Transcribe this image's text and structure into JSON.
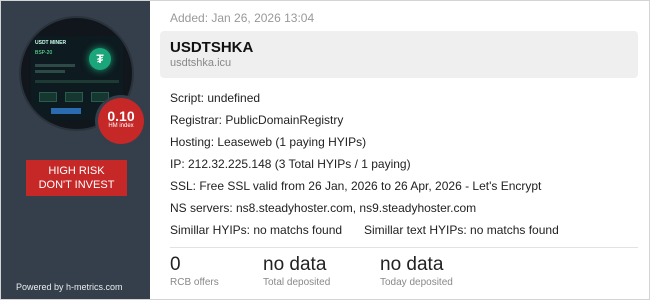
{
  "sidebar": {
    "thumbnail": {
      "site_name": "USDT MINER",
      "badge": "BSP-20"
    },
    "score": {
      "value": "0.10",
      "label": "HM index"
    },
    "risk": {
      "line1": "HIGH RISK",
      "line2": "DON'T INVEST"
    },
    "powered_by": "Powered by h-metrics.com"
  },
  "header": {
    "added": "Added: Jan 26, 2026 13:04",
    "title": "USDTSHKA",
    "domain": "usdtshka.icu"
  },
  "details": {
    "script": "Script: undefined",
    "registrar": "Registrar: PublicDomainRegistry",
    "hosting": "Hosting: Leaseweb (1 paying HYIPs)",
    "ip": "IP: 212.32.225.148 (3 Total HYIPs / 1 paying)",
    "ssl": "SSL: Free SSL valid from 26 Jan, 2026 to 26 Apr, 2026 - Let's Encrypt",
    "ns": "NS servers: ns8.steadyhoster.com, ns9.steadyhoster.com",
    "similar_hyips": "Simillar HYIPs: no matchs found",
    "similar_text": "Simillar text HYIPs: no matchs found"
  },
  "stats": [
    {
      "value": "0",
      "label": "RCB offers"
    },
    {
      "value": "no data",
      "label": "Total deposited"
    },
    {
      "value": "no data",
      "label": "Today deposited"
    }
  ],
  "colors": {
    "sidebar_bg": "#343f4b",
    "risk_red": "#c62828",
    "title_box_bg": "#efefef"
  }
}
